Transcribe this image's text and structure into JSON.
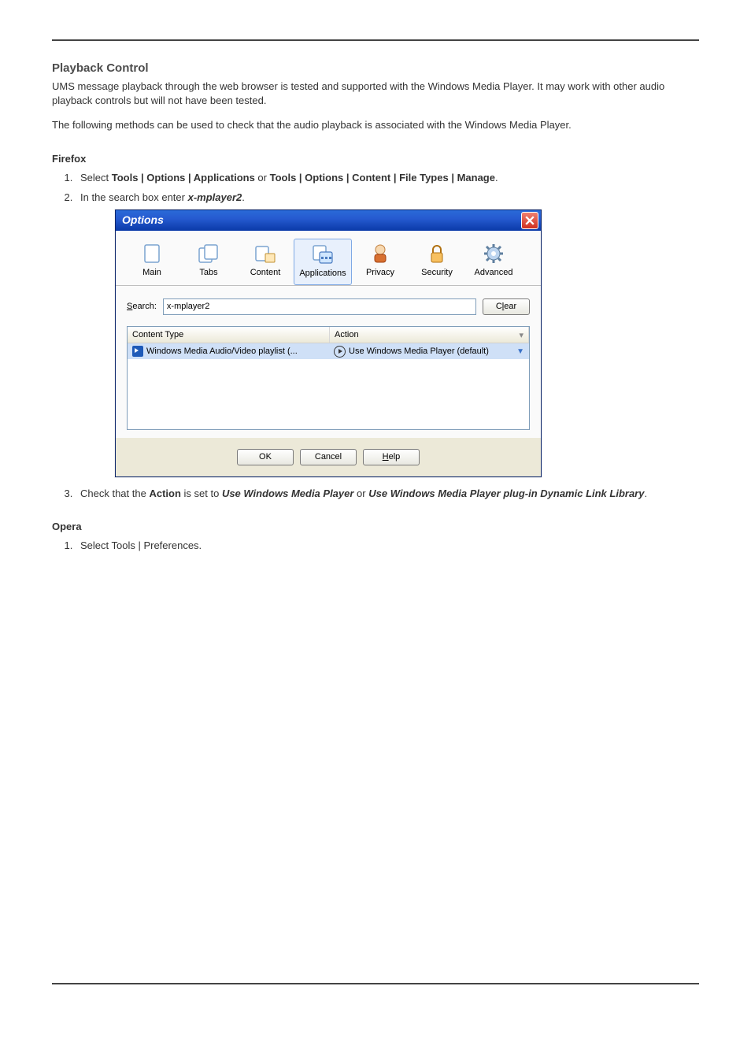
{
  "doc": {
    "title": "Playback Control",
    "para1": "UMS message playback through the web browser is tested and supported with the Windows Media Player. It may work with other audio playback controls but will not have been tested.",
    "para2": "The following methods can be used to check that the audio playback is associated with the Windows Media Player."
  },
  "firefox": {
    "heading": "Firefox",
    "step1_prefix": "Select ",
    "step1_bold1": "Tools | Options | Applications",
    "step1_mid": " or ",
    "step1_bold2": "Tools | Options | Content | File Types | Manage",
    "step1_suffix": ".",
    "step2_prefix": "In the search box enter ",
    "step2_ital": "x-mplayer2",
    "step2_suffix": ".",
    "step3_prefix": "Check that the ",
    "step3_bold1": "Action",
    "step3_mid1": " is set to ",
    "step3_ital1": "Use Windows Media Player",
    "step3_mid2": " or ",
    "step3_ital2": "Use Windows Media Player plug-in Dynamic Link Library",
    "step3_suffix": "."
  },
  "opera": {
    "heading": "Opera",
    "step1": "Select Tools | Preferences."
  },
  "dialog": {
    "title": "Options",
    "tabs": {
      "main": "Main",
      "tabs": "Tabs",
      "content": "Content",
      "applications": "Applications",
      "privacy": "Privacy",
      "security": "Security",
      "advanced": "Advanced"
    },
    "search_label_pre": "S",
    "search_label_post": "earch:",
    "search_value": "x-mplayer2",
    "clear_pre": "C",
    "clear_mid": "l",
    "clear_post": "ear",
    "col_content_type": "Content Type",
    "col_action": "Action",
    "row_content_type": "Windows Media Audio/Video playlist (...",
    "row_action": "Use Windows Media Player (default)",
    "ok": "OK",
    "cancel": "Cancel",
    "help_pre": "H",
    "help_post": "elp"
  }
}
